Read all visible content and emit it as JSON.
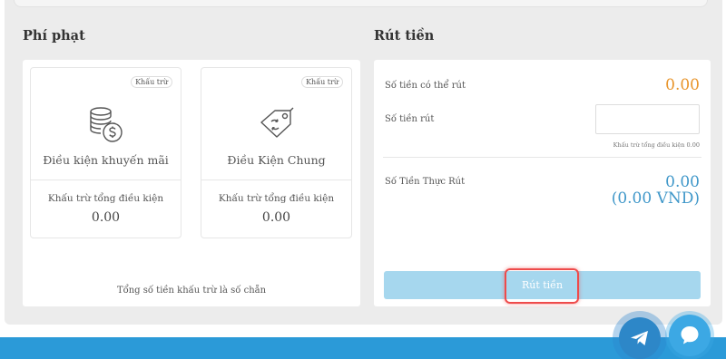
{
  "penalty": {
    "title": "Phí phạt",
    "cards": [
      {
        "badge": "Khấu trừ",
        "icon": "coins-dollar-icon",
        "name": "Điều kiện khuyến mãi",
        "sub_label": "Khấu trừ tổng điều kiện",
        "value": "0.00"
      },
      {
        "badge": "Khấu trừ",
        "icon": "tag-cycle-icon",
        "name": "Điều Kiện Chung",
        "sub_label": "Khấu trừ tổng điều kiện",
        "value": "0.00"
      }
    ],
    "note": "Tổng số tiền khấu trừ là số chẵn"
  },
  "withdraw": {
    "title": "Rút tiền",
    "available_label": "Số tiền có thể rút",
    "available_value": "0.00",
    "amount_label": "Số tiền rút",
    "amount_value": "",
    "amount_hint": "Khấu trừ tổng điều kiện 0.00",
    "actual_label": "Số Tiền Thực Rút",
    "actual_value": "0.00",
    "actual_vnd": "(0.00 VND)",
    "button_label": "Rút tiền"
  },
  "floating": {
    "telegram_icon": "telegram-icon",
    "chat_icon": "chat-bubble-icon"
  },
  "colors": {
    "accent_orange": "#e8942a",
    "accent_blue": "#3f97c9",
    "button_bg": "#a6d7ee",
    "footer_bg": "#2b9ad8",
    "highlight": "#ee4b4b"
  }
}
